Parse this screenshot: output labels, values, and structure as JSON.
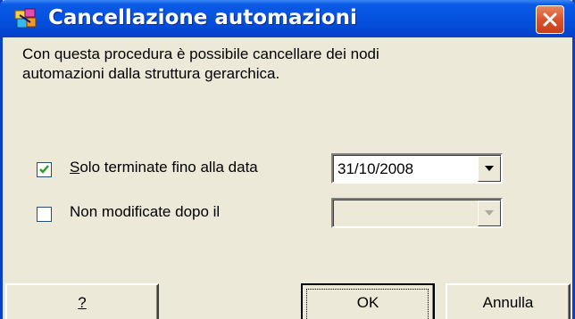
{
  "window": {
    "title": "Cancellazione automazioni",
    "icon": "automation-app-icon",
    "close_icon": "close-icon"
  },
  "description": {
    "line1": "Con questa procedura è possibile cancellare dei nodi",
    "line2": "automazioni dalla struttura gerarchica."
  },
  "options": {
    "solo_terminate": {
      "label_mnemonic": "S",
      "label_rest": "olo terminate fino alla data",
      "checked": true,
      "date_value": "31/10/2008",
      "enabled": true
    },
    "non_modificate": {
      "label": "Non modificate dopo il",
      "checked": false,
      "date_value": "",
      "enabled": false
    }
  },
  "buttons": {
    "help": "?",
    "ok": "OK",
    "cancel": "Annulla"
  },
  "colors": {
    "titlebar": "#0551e0",
    "frame": "#0a3fc8",
    "dialog_bg": "#ece9d8",
    "close_button": "#d9542c"
  }
}
